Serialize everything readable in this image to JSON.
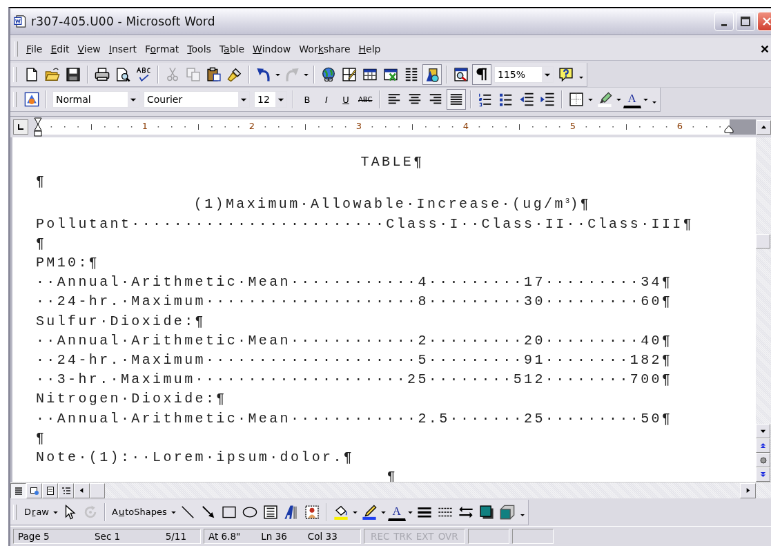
{
  "window": {
    "title": "r307-405.U00 - Microsoft Word"
  },
  "menu": [
    {
      "key": "F",
      "post": "ile"
    },
    {
      "key": "E",
      "post": "dit"
    },
    {
      "key": "V",
      "post": "iew"
    },
    {
      "key": "I",
      "post": "nsert"
    },
    {
      "pre": "F",
      "key": "o",
      "post": "rmat"
    },
    {
      "key": "T",
      "post": "ools"
    },
    {
      "pre": "T",
      "key": "a",
      "post": "ble"
    },
    {
      "key": "W",
      "post": "indow"
    },
    {
      "pre": "Wor",
      "key": "k",
      "post": "share"
    },
    {
      "key": "H",
      "post": "elp"
    }
  ],
  "toolbar_standard": [
    {
      "kind": "new",
      "pressed": false,
      "disabled": false
    },
    {
      "kind": "open",
      "pressed": false,
      "disabled": false
    },
    {
      "kind": "save",
      "pressed": false,
      "disabled": false
    },
    {
      "kind": "sep"
    },
    {
      "kind": "print",
      "pressed": false,
      "disabled": false
    },
    {
      "kind": "preview",
      "pressed": false,
      "disabled": false
    },
    {
      "kind": "spell"
    },
    {
      "kind": "sep"
    },
    {
      "kind": "cut",
      "pressed": false,
      "disabled": true
    },
    {
      "kind": "copy",
      "pressed": false,
      "disabled": true
    },
    {
      "kind": "paste",
      "pressed": false,
      "disabled": false
    },
    {
      "kind": "painter",
      "pressed": false,
      "disabled": false
    },
    {
      "kind": "sep"
    },
    {
      "kind": "undo",
      "pressed": false,
      "disabled": false
    },
    {
      "kind": "redo",
      "pressed": false,
      "disabled": true
    },
    {
      "kind": "sep"
    },
    {
      "kind": "web",
      "pressed": false,
      "disabled": false
    },
    {
      "kind": "tables_borders",
      "pressed": false,
      "disabled": false
    },
    {
      "kind": "insert_table",
      "pressed": false,
      "disabled": false
    },
    {
      "kind": "insert_excel",
      "pressed": false,
      "disabled": false
    },
    {
      "kind": "columns",
      "pressed": false,
      "disabled": false
    },
    {
      "kind": "drawing",
      "pressed": true,
      "disabled": false
    },
    {
      "kind": "sep"
    },
    {
      "kind": "document_map",
      "pressed": false,
      "disabled": false
    },
    {
      "kind": "show_marks",
      "pressed": true,
      "disabled": false
    },
    {
      "kind": "zoom",
      "value": "115%"
    },
    {
      "kind": "help",
      "pressed": false,
      "disabled": false
    },
    {
      "kind": "chevron"
    }
  ],
  "toolbar_formatting": [
    {
      "kind": "shapes",
      "pressed": false,
      "disabled": false
    },
    {
      "kind": "sep"
    },
    {
      "kind": "style",
      "value": "Normal"
    },
    {
      "kind": "font",
      "value": "Courier"
    },
    {
      "kind": "size",
      "value": "12"
    },
    {
      "kind": "sep"
    },
    {
      "kind": "bold",
      "label": "B",
      "pressed": false,
      "disabled": false
    },
    {
      "kind": "italic",
      "label": "I",
      "pressed": false,
      "disabled": false
    },
    {
      "kind": "underline",
      "label": "U",
      "pressed": false,
      "disabled": false
    },
    {
      "kind": "strike",
      "label": "ABC",
      "pressed": false,
      "disabled": false
    },
    {
      "kind": "sep"
    },
    {
      "kind": "align_left",
      "pressed": false,
      "disabled": false
    },
    {
      "kind": "center",
      "pressed": false,
      "disabled": false
    },
    {
      "kind": "align_right",
      "pressed": false,
      "disabled": false
    },
    {
      "kind": "justify",
      "pressed": true,
      "disabled": false
    },
    {
      "kind": "sep"
    },
    {
      "kind": "numbering",
      "pressed": false,
      "disabled": false
    },
    {
      "kind": "bullets",
      "pressed": false,
      "disabled": false
    },
    {
      "kind": "outdent",
      "pressed": false,
      "disabled": false
    },
    {
      "kind": "indent",
      "pressed": false,
      "disabled": false
    },
    {
      "kind": "sep"
    },
    {
      "kind": "borders",
      "pressed": false,
      "disabled": false
    },
    {
      "kind": "highlight",
      "pressed": false,
      "disabled": false
    },
    {
      "kind": "font_color",
      "label": "A",
      "pressed": false,
      "disabled": false
    },
    {
      "kind": "chevron"
    }
  ],
  "ruler": {
    "numbers": [
      "1",
      "2",
      "3",
      "4",
      "5",
      "6"
    ]
  },
  "document": {
    "lines": [
      {
        "kind": "center",
        "text": "TABLE¶"
      },
      {
        "kind": "left",
        "text": "¶"
      },
      {
        "kind": "center",
        "text": "(1)Maximum·Allowable·Increase·(ug/m$^{3}$)¶"
      },
      {
        "kind": "left",
        "text": "Pollutant························Class·I··Class·II··Class·III¶"
      },
      {
        "kind": "left",
        "text": "¶"
      },
      {
        "kind": "left",
        "text": "PM10:¶"
      },
      {
        "kind": "left",
        "text": "··Annual·Arithmetic·Mean············4·········17·········34¶"
      },
      {
        "kind": "left",
        "text": "··24-hr.·Maximum····················8·········30·········60¶"
      },
      {
        "kind": "left",
        "text": "Sulfur·Dioxide:¶"
      },
      {
        "kind": "left",
        "text": "··Annual·Arithmetic·Mean············2·········20·········40¶"
      },
      {
        "kind": "left",
        "text": "··24-hr.·Maximum····················5·········91········182¶"
      },
      {
        "kind": "left",
        "text": "··3-hr.·Maximum····················25········512········700¶"
      },
      {
        "kind": "left",
        "text": "Nitrogen·Dioxide:¶"
      },
      {
        "kind": "left",
        "text": "··Annual·Arithmetic·Mean············2.5·······25·········50¶"
      },
      {
        "kind": "left",
        "text": "¶"
      },
      {
        "kind": "left",
        "text": "Note·(1):··Lorem·ipsum·dolor.¶"
      },
      {
        "kind": "center",
        "text": "¶"
      }
    ]
  },
  "view_buttons": [
    {
      "kind": "normal",
      "selected": true
    },
    {
      "kind": "web",
      "selected": false
    },
    {
      "kind": "print",
      "selected": false
    },
    {
      "kind": "outline",
      "selected": false
    }
  ],
  "toolbar_drawing": [
    {
      "kind": "menu",
      "pre": "D",
      "key": "r",
      "post": "aw"
    },
    {
      "kind": "select",
      "pressed": false,
      "disabled": false
    },
    {
      "kind": "rotate",
      "pressed": false,
      "disabled": true
    },
    {
      "kind": "sep"
    },
    {
      "kind": "menu",
      "pre": "A",
      "key": "u",
      "post": "toShapes"
    },
    {
      "kind": "line",
      "pressed": false,
      "disabled": false
    },
    {
      "kind": "arrow",
      "pressed": false,
      "disabled": false
    },
    {
      "kind": "rectangle",
      "pressed": false,
      "disabled": false
    },
    {
      "kind": "oval",
      "pressed": false,
      "disabled": false
    },
    {
      "kind": "textbox",
      "pressed": false,
      "disabled": false
    },
    {
      "kind": "wordart",
      "pressed": false,
      "disabled": false
    },
    {
      "kind": "clipart",
      "pressed": false,
      "disabled": false
    },
    {
      "kind": "sep"
    },
    {
      "kind": "fill",
      "pressed": false,
      "disabled": false
    },
    {
      "kind": "line_color",
      "pressed": false,
      "disabled": false
    },
    {
      "kind": "font_color",
      "label": "A",
      "pressed": false,
      "disabled": false
    },
    {
      "kind": "line_style",
      "pressed": false,
      "disabled": false
    },
    {
      "kind": "dash_style",
      "pressed": false,
      "disabled": false
    },
    {
      "kind": "arrow_style",
      "pressed": false,
      "disabled": false
    },
    {
      "kind": "shadow",
      "pressed": false,
      "disabled": false
    },
    {
      "kind": "threed",
      "pressed": false,
      "disabled": false
    },
    {
      "kind": "chevron"
    }
  ],
  "status_bar": {
    "panes": [
      [
        "Page 5",
        "Sec 1",
        "5/11"
      ],
      [
        "At 6.8\"",
        "Ln 36",
        "Col 33"
      ]
    ],
    "indicators": [
      {
        "text": "REC",
        "enabled": false
      },
      {
        "text": "TRK",
        "enabled": false
      },
      {
        "text": "EXT",
        "enabled": false
      },
      {
        "text": "OVR",
        "enabled": false
      }
    ]
  }
}
